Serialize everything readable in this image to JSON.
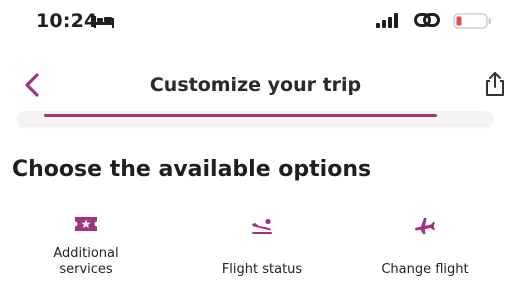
{
  "status_bar": {
    "time": "10:24",
    "bed_icon": "bed-icon",
    "signal_icon": "cellular-signal-icon",
    "link_icon": "link-icon",
    "battery_icon": "battery-low-icon",
    "battery_color": "#e24b4b"
  },
  "header": {
    "back_icon": "chevron-left-icon",
    "title": "Customize your trip",
    "share_icon": "share-icon",
    "progress_fraction": 0.93,
    "progress_color": "#a2337f"
  },
  "section": {
    "title": "Choose the available options"
  },
  "options": [
    {
      "label_lines": [
        "Additional",
        "services"
      ],
      "icon": "ticket-icon"
    },
    {
      "label": "Flight status",
      "icon": "flight-landing-icon"
    },
    {
      "label": "Change flight",
      "icon": "flight-change-icon"
    }
  ],
  "colors": {
    "accent": "#a2337f",
    "text": "#1f1f1f"
  }
}
